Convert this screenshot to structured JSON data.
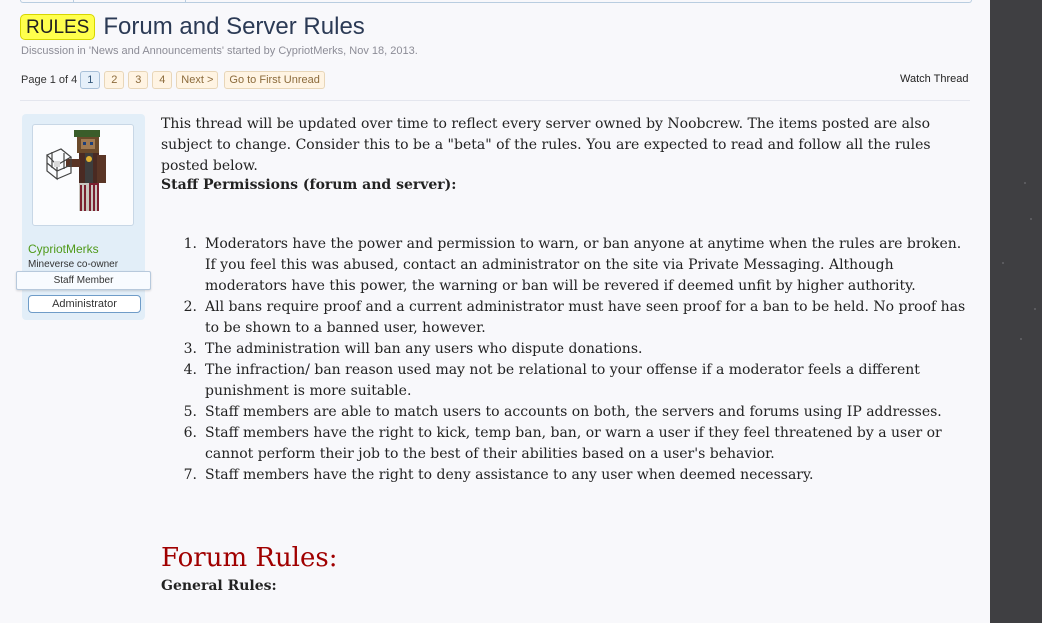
{
  "thread": {
    "prefix": "RULES",
    "title": "Forum and Server Rules",
    "meta_prefix": "Discussion in '",
    "forum_name": "News and Announcements",
    "meta_middle": "' started by ",
    "author": "CypriotMerks",
    "meta_sep": ", ",
    "date": "Nov 18, 2013",
    "meta_end": "."
  },
  "pagenav": {
    "label": "Page 1 of 4",
    "pages": [
      "1",
      "2",
      "3",
      "4"
    ],
    "current": "1",
    "next_label": "Next >",
    "first_unread_label": "Go to First Unread"
  },
  "watch_label": "Watch Thread",
  "user": {
    "name": "CypriotMerks",
    "user_title": "Mineverse co-owner",
    "staff_banner": "Staff Member",
    "role_badge": "Administrator",
    "name_color": "#4f9a1a"
  },
  "post": {
    "intro": "This thread will be updated over time to reflect every server owned by Noobcrew. The items posted are also subject to change. Consider this to be a \"beta\" of the rules. You are expected to read and follow all the rules posted below.",
    "staff_heading": "Staff Permissions (forum and server):",
    "rules": [
      {
        "num": "1.",
        "text": "Moderators have the power and permission to warn, or ban anyone at anytime when the rules are broken. If you feel this was abused, contact an administrator on the site via Private Messaging. Although moderators have this power, the warning or ban will be revered if deemed unfit by higher authority."
      },
      {
        "num": "2.",
        "text": "All bans require proof and a current administrator must have seen proof for a ban to be held. No proof has to be shown to a banned user, however."
      },
      {
        "num": "3.",
        "text": "The administration will ban any users who dispute donations."
      },
      {
        "num": "4.",
        "text": "The infraction/ ban reason used may not be relational to your offense if a moderator feels a different punishment is more suitable."
      },
      {
        "num": "5.",
        "text": "Staff members are able to match users to accounts on both, the servers and forums using IP addresses."
      },
      {
        "num": "6.",
        "text": "Staff members have the right to kick, temp ban, ban, or warn a user if they feel threatened by a user or cannot perform their job to the best of their abilities based on a user's behavior."
      },
      {
        "num": "7.",
        "text": "Staff members have the right to deny assistance to any user when deemed necessary."
      }
    ],
    "forum_rules_heading": "Forum Rules:",
    "general_rules_heading": "General Rules:",
    "forum_rules_color": "#a00000"
  },
  "colors": {
    "prefix_bg": "#ffff4d",
    "title": "#2b3a55",
    "userbox_bg": "#e2eef8",
    "right_panel": "#3f3f42"
  }
}
